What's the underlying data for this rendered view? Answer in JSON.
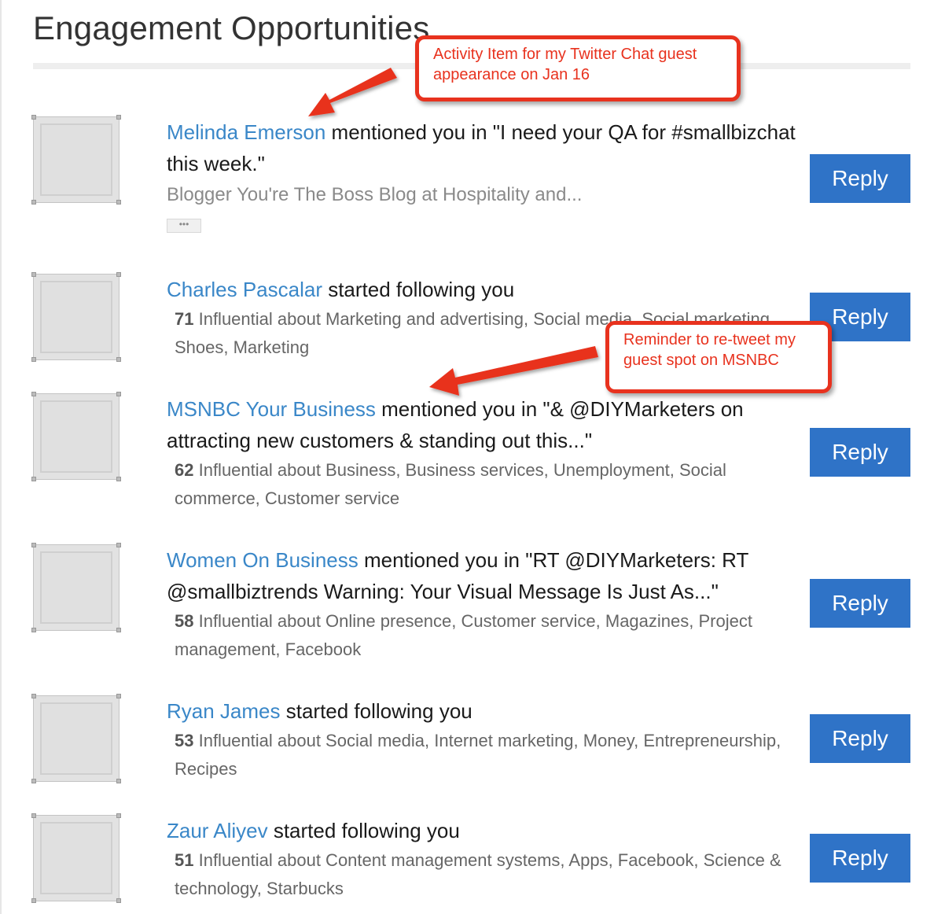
{
  "page": {
    "title": "Engagement Opportunities"
  },
  "annotations": [
    {
      "text": "Activity Item for my Twitter Chat guest appearance on Jan 16",
      "color": "#e8321e"
    },
    {
      "text": "Reminder to re-tweet my guest spot on MSNBC",
      "color": "#e8321e"
    }
  ],
  "items": [
    {
      "name": "Melinda Emerson",
      "action": " mentioned you in \"I need your QA for #smallbizchat this week.\"",
      "subtitle": "Blogger You're The Boss Blog at Hospitality and...",
      "ellipsis": "•••",
      "reply_label": "Reply"
    },
    {
      "name": "Charles Pascalar",
      "action": " started following you",
      "score": "71",
      "influence": " Influential about Marketing and advertising, Social media, Social marketing, Shoes, Marketing",
      "reply_label": "Reply"
    },
    {
      "name": "MSNBC Your Business",
      "action": " mentioned you in \"& @DIYMarketers on attracting new customers & standing out this...\"",
      "score": "62",
      "influence": " Influential about Business, Business services, Unemployment, Social commerce, Customer service",
      "reply_label": "Reply"
    },
    {
      "name": "Women On Business",
      "action": " mentioned you in \"RT @DIYMarketers: RT @smallbiztrends Warning: Your Visual Message Is Just As...\"",
      "score": "58",
      "influence": " Influential about Online presence, Customer service, Magazines, Project management, Facebook",
      "reply_label": "Reply"
    },
    {
      "name": "Ryan James",
      "action": " started following you",
      "score": "53",
      "influence": " Influential about Social media, Internet marketing, Money, Entrepreneurship, Recipes",
      "reply_label": "Reply"
    },
    {
      "name": "Zaur Aliyev",
      "action": " started following you",
      "score": "51",
      "influence": " Influential about Content management systems, Apps, Facebook, Science & technology, Starbucks",
      "reply_label": "Reply"
    }
  ]
}
